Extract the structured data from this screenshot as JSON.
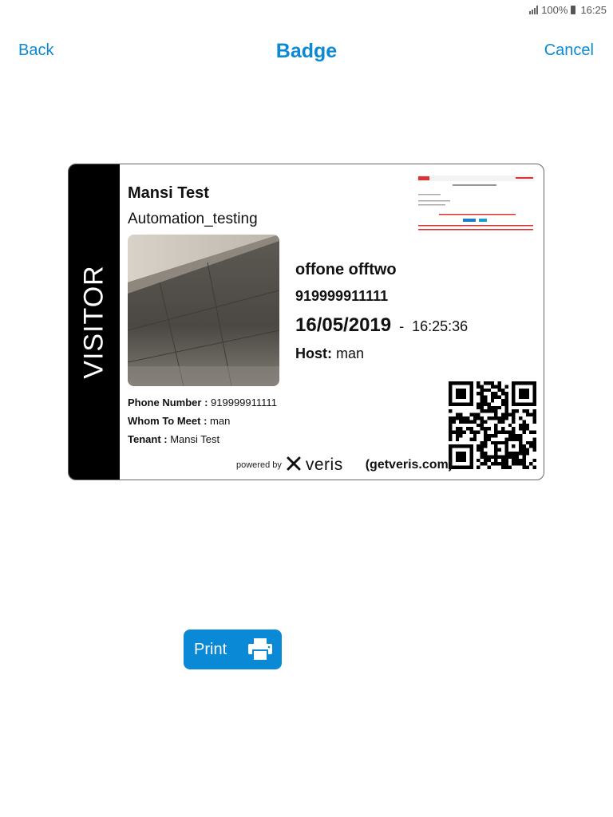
{
  "status_bar": {
    "battery": "100%",
    "time": "16:25"
  },
  "header": {
    "back_label": "Back",
    "title": "Badge",
    "cancel_label": "Cancel"
  },
  "badge": {
    "side_label": "VISITOR",
    "visitor_name": "Mansi Test",
    "visitor_company": "Automation_testing",
    "host_person": "offone offtwo",
    "host_phone": "919999911111",
    "date": "16/05/2019",
    "date_separator": "-",
    "time": "16:25:36",
    "host_label": "Host:",
    "host_value": "man",
    "details": [
      {
        "label": "Phone Number :",
        "value": "919999911111"
      },
      {
        "label": "Whom To Meet :",
        "value": "man"
      },
      {
        "label": "Tenant :",
        "value": "Mansi Test"
      }
    ],
    "powered_by": "powered by",
    "brand": "veris",
    "brand_domain": "(getveris.com)"
  },
  "print_button": {
    "label": "Print",
    "icon": "printer-icon"
  },
  "colors": {
    "accent": "#0a8ad6",
    "badge_side": "#000000"
  }
}
